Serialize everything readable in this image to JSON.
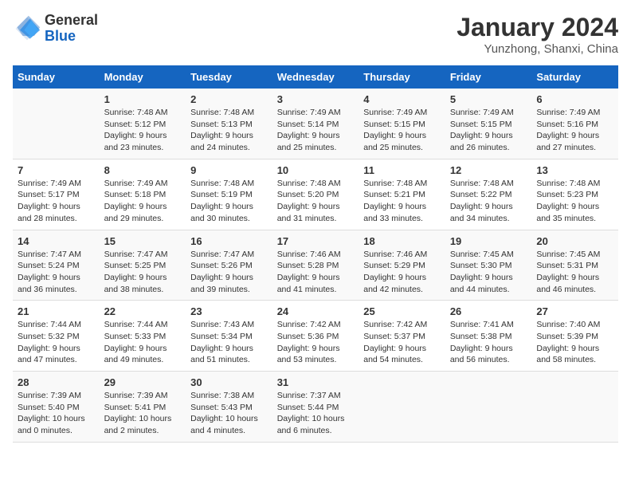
{
  "header": {
    "logo_general": "General",
    "logo_blue": "Blue",
    "month_title": "January 2024",
    "location": "Yunzhong, Shanxi, China"
  },
  "days_of_week": [
    "Sunday",
    "Monday",
    "Tuesday",
    "Wednesday",
    "Thursday",
    "Friday",
    "Saturday"
  ],
  "weeks": [
    [
      {
        "day": "",
        "info": ""
      },
      {
        "day": "1",
        "info": "Sunrise: 7:48 AM\nSunset: 5:12 PM\nDaylight: 9 hours\nand 23 minutes."
      },
      {
        "day": "2",
        "info": "Sunrise: 7:48 AM\nSunset: 5:13 PM\nDaylight: 9 hours\nand 24 minutes."
      },
      {
        "day": "3",
        "info": "Sunrise: 7:49 AM\nSunset: 5:14 PM\nDaylight: 9 hours\nand 25 minutes."
      },
      {
        "day": "4",
        "info": "Sunrise: 7:49 AM\nSunset: 5:15 PM\nDaylight: 9 hours\nand 25 minutes."
      },
      {
        "day": "5",
        "info": "Sunrise: 7:49 AM\nSunset: 5:15 PM\nDaylight: 9 hours\nand 26 minutes."
      },
      {
        "day": "6",
        "info": "Sunrise: 7:49 AM\nSunset: 5:16 PM\nDaylight: 9 hours\nand 27 minutes."
      }
    ],
    [
      {
        "day": "7",
        "info": "Sunrise: 7:49 AM\nSunset: 5:17 PM\nDaylight: 9 hours\nand 28 minutes."
      },
      {
        "day": "8",
        "info": "Sunrise: 7:49 AM\nSunset: 5:18 PM\nDaylight: 9 hours\nand 29 minutes."
      },
      {
        "day": "9",
        "info": "Sunrise: 7:48 AM\nSunset: 5:19 PM\nDaylight: 9 hours\nand 30 minutes."
      },
      {
        "day": "10",
        "info": "Sunrise: 7:48 AM\nSunset: 5:20 PM\nDaylight: 9 hours\nand 31 minutes."
      },
      {
        "day": "11",
        "info": "Sunrise: 7:48 AM\nSunset: 5:21 PM\nDaylight: 9 hours\nand 33 minutes."
      },
      {
        "day": "12",
        "info": "Sunrise: 7:48 AM\nSunset: 5:22 PM\nDaylight: 9 hours\nand 34 minutes."
      },
      {
        "day": "13",
        "info": "Sunrise: 7:48 AM\nSunset: 5:23 PM\nDaylight: 9 hours\nand 35 minutes."
      }
    ],
    [
      {
        "day": "14",
        "info": "Sunrise: 7:47 AM\nSunset: 5:24 PM\nDaylight: 9 hours\nand 36 minutes."
      },
      {
        "day": "15",
        "info": "Sunrise: 7:47 AM\nSunset: 5:25 PM\nDaylight: 9 hours\nand 38 minutes."
      },
      {
        "day": "16",
        "info": "Sunrise: 7:47 AM\nSunset: 5:26 PM\nDaylight: 9 hours\nand 39 minutes."
      },
      {
        "day": "17",
        "info": "Sunrise: 7:46 AM\nSunset: 5:28 PM\nDaylight: 9 hours\nand 41 minutes."
      },
      {
        "day": "18",
        "info": "Sunrise: 7:46 AM\nSunset: 5:29 PM\nDaylight: 9 hours\nand 42 minutes."
      },
      {
        "day": "19",
        "info": "Sunrise: 7:45 AM\nSunset: 5:30 PM\nDaylight: 9 hours\nand 44 minutes."
      },
      {
        "day": "20",
        "info": "Sunrise: 7:45 AM\nSunset: 5:31 PM\nDaylight: 9 hours\nand 46 minutes."
      }
    ],
    [
      {
        "day": "21",
        "info": "Sunrise: 7:44 AM\nSunset: 5:32 PM\nDaylight: 9 hours\nand 47 minutes."
      },
      {
        "day": "22",
        "info": "Sunrise: 7:44 AM\nSunset: 5:33 PM\nDaylight: 9 hours\nand 49 minutes."
      },
      {
        "day": "23",
        "info": "Sunrise: 7:43 AM\nSunset: 5:34 PM\nDaylight: 9 hours\nand 51 minutes."
      },
      {
        "day": "24",
        "info": "Sunrise: 7:42 AM\nSunset: 5:36 PM\nDaylight: 9 hours\nand 53 minutes."
      },
      {
        "day": "25",
        "info": "Sunrise: 7:42 AM\nSunset: 5:37 PM\nDaylight: 9 hours\nand 54 minutes."
      },
      {
        "day": "26",
        "info": "Sunrise: 7:41 AM\nSunset: 5:38 PM\nDaylight: 9 hours\nand 56 minutes."
      },
      {
        "day": "27",
        "info": "Sunrise: 7:40 AM\nSunset: 5:39 PM\nDaylight: 9 hours\nand 58 minutes."
      }
    ],
    [
      {
        "day": "28",
        "info": "Sunrise: 7:39 AM\nSunset: 5:40 PM\nDaylight: 10 hours\nand 0 minutes."
      },
      {
        "day": "29",
        "info": "Sunrise: 7:39 AM\nSunset: 5:41 PM\nDaylight: 10 hours\nand 2 minutes."
      },
      {
        "day": "30",
        "info": "Sunrise: 7:38 AM\nSunset: 5:43 PM\nDaylight: 10 hours\nand 4 minutes."
      },
      {
        "day": "31",
        "info": "Sunrise: 7:37 AM\nSunset: 5:44 PM\nDaylight: 10 hours\nand 6 minutes."
      },
      {
        "day": "",
        "info": ""
      },
      {
        "day": "",
        "info": ""
      },
      {
        "day": "",
        "info": ""
      }
    ]
  ]
}
